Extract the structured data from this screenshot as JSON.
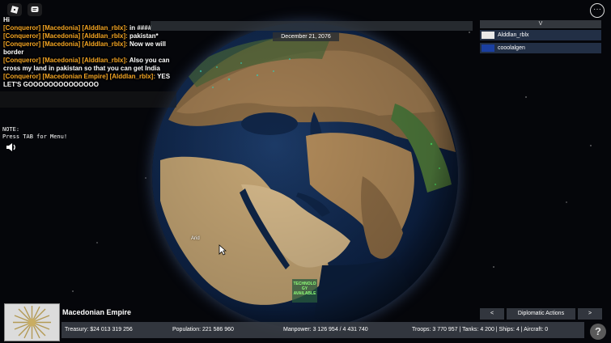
{
  "date": "December 21, 2076",
  "chat": {
    "partial_top": "Hi",
    "messages": [
      {
        "prefix": "[Conqueror] [Macedonia] [Alddlan_rblx]:",
        "text": "in ####"
      },
      {
        "prefix": "[Conqueror] [Macedonia] [Alddlan_rblx]:",
        "text": "pakistan*"
      },
      {
        "prefix": "[Conqueror] [Macedonia] [Alddlan_rblx]:",
        "text": "Now we will border"
      },
      {
        "prefix": "[Conqueror] [Macedonia] [Alddlan_rblx]:",
        "text": "Also you can cross my land in pakistan so that you can get India"
      },
      {
        "prefix": "[Conqueror] [Macedonian Empire] [Alddlan_rblx]:",
        "text": "YES LET'S GOOOOOOOOOOOOOO"
      }
    ]
  },
  "note": {
    "line1": "NOTE:",
    "line2": "Press TAB for Menu!"
  },
  "players": {
    "header": "V",
    "list": [
      {
        "name": "Alddlan_rblx",
        "flag_color": "#e8e8e8"
      },
      {
        "name": "cooolalgen",
        "flag_color": "#1a3fa0"
      }
    ]
  },
  "map_labels": {
    "tech_line1": "TECHNOLO",
    "tech_line2": "GY",
    "tech_line3": "AVAILABLE",
    "region": "Arid"
  },
  "nation": {
    "name": "Macedonian Empire"
  },
  "stats": {
    "treasury": "Treasury:  $24 013 319 256",
    "population": "Population:  221 586 960",
    "manpower": "Manpower:  3 126 954  /  4 431 740",
    "military": "Troops: 3 770 957  |  Tanks: 4 200  |  Ships: 4  |  Aircraft: 0"
  },
  "buttons": {
    "prev": "<",
    "diplomatic": "Diplomatic Actions",
    "next": ">",
    "help": "?",
    "menu": "···"
  },
  "colors": {
    "tag_orange": "#f4a523",
    "tech_green": "#8fff7a"
  }
}
